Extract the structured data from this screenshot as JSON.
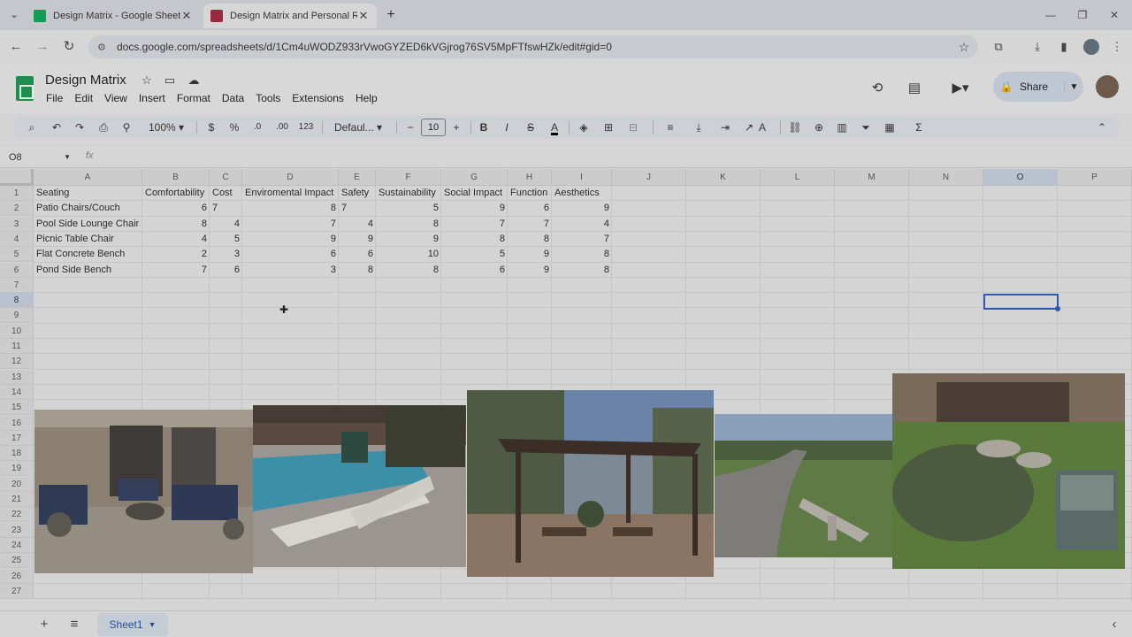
{
  "browser": {
    "tabs": [
      {
        "title": "Design Matrix - Google Sheets",
        "close": "✕"
      },
      {
        "title": "Design Matrix and Personal Ref",
        "close": "✕"
      }
    ],
    "new_tab": "+",
    "url": "docs.google.com/spreadsheets/d/1Cm4uWODZ933rVwoGYZED6kVGjrog76SV5MpFTfswHZk/edit#gid=0"
  },
  "doc": {
    "title": "Design Matrix",
    "menus": [
      "File",
      "Edit",
      "View",
      "Insert",
      "Format",
      "Data",
      "Tools",
      "Extensions",
      "Help"
    ],
    "share_label": "Share"
  },
  "toolbar": {
    "zoom": "100%",
    "currency": "$",
    "percent": "%",
    "dec_less": ".0",
    "dec_more": ".00",
    "number_format": "123",
    "font": "Defaul...",
    "font_size": "10",
    "bold": "B",
    "italic": "I",
    "strike": "S",
    "text_color": "A",
    "text_color_hex": "#000000"
  },
  "formula_bar": {
    "name_box": "O8",
    "fx": "fx"
  },
  "grid": {
    "columns": [
      "A",
      "B",
      "C",
      "D",
      "E",
      "F",
      "G",
      "H",
      "I",
      "J",
      "K",
      "L",
      "M",
      "N",
      "O",
      "P"
    ],
    "selected_column": "O",
    "rows": [
      "1",
      "2",
      "3",
      "4",
      "5",
      "6",
      "7",
      "8",
      "9",
      "10",
      "11",
      "12",
      "13",
      "14",
      "15",
      "16",
      "17",
      "18",
      "19",
      "20",
      "21",
      "22",
      "23",
      "24",
      "25",
      "26",
      "27"
    ],
    "selected_row": "8",
    "headers": [
      "Seating",
      "Comfortability",
      "Cost",
      "Enviromental Impact",
      "Safety",
      "Sustainability",
      "Social Impact",
      "Function",
      "Aesthetics"
    ],
    "data": [
      {
        "name": "Patio Chairs/Couch",
        "values": [
          "6",
          "7",
          "8",
          "7",
          "5",
          "9",
          "6",
          "9"
        ]
      },
      {
        "name": "Pool Side Lounge Chair",
        "values": [
          "8",
          "4",
          "7",
          "4",
          "8",
          "7",
          "7",
          "4"
        ]
      },
      {
        "name": "Picnic Table Chair",
        "values": [
          "4",
          "5",
          "9",
          "9",
          "9",
          "8",
          "8",
          "7"
        ]
      },
      {
        "name": "Flat Concrete Bench",
        "values": [
          "2",
          "3",
          "6",
          "6",
          "10",
          "5",
          "9",
          "8"
        ]
      },
      {
        "name": "Pond Side Bench",
        "values": [
          "7",
          "6",
          "3",
          "8",
          "8",
          "6",
          "9",
          "8"
        ]
      }
    ],
    "left_aligned": [
      [
        "B1",
        "C1"
      ],
      [
        "B1",
        "E1"
      ]
    ],
    "accent": "#2f59b8"
  },
  "sheets": {
    "active": "Sheet1"
  }
}
